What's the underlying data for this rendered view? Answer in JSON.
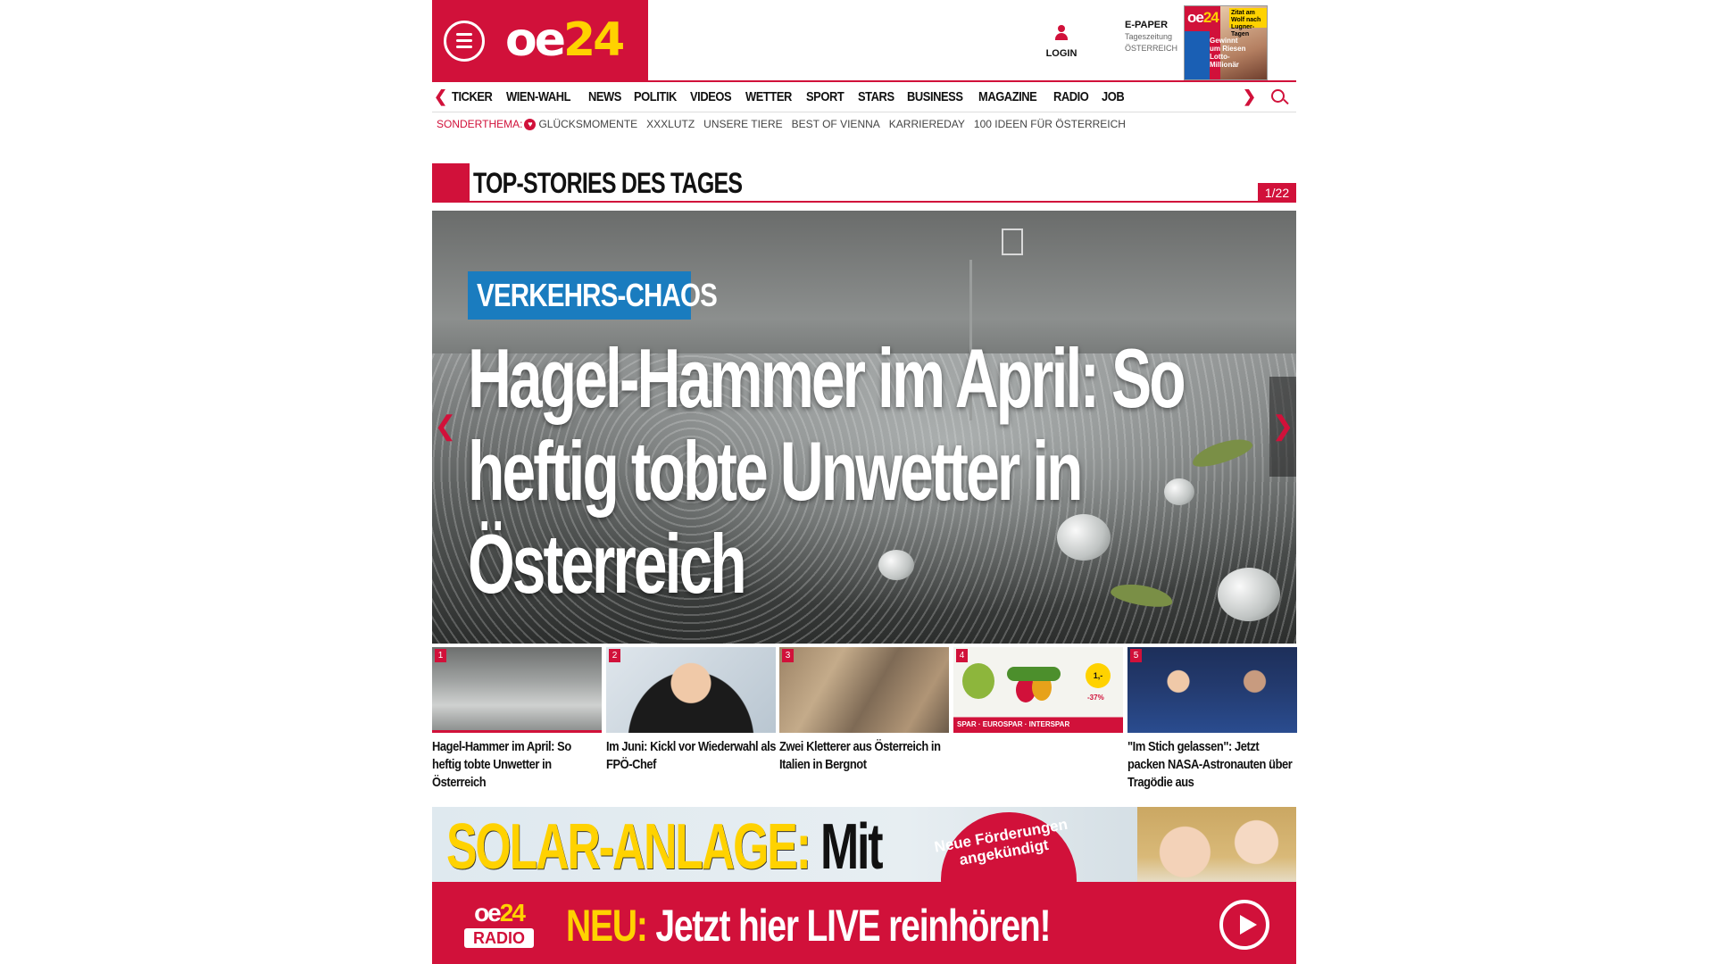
{
  "header": {
    "logo": {
      "part1": "oe",
      "part2": "24"
    },
    "login_label": "LOGIN",
    "epaper": {
      "title": "E-PAPER",
      "subtitle_1": "Tageszeitung",
      "subtitle_2": "ÖSTERREICH",
      "cover_logo_1": "oe",
      "cover_logo_2": "24",
      "cover_headline": "Gewinnt um Riesen Lotto-Millionär",
      "cover_badge": "Zitat am Wolf nach Lugner-Tagen"
    }
  },
  "nav": {
    "items": [
      "TICKER",
      "WIEN-WAHL",
      "NEWS",
      "POLITIK",
      "VIDEOS",
      "WETTER",
      "SPORT",
      "STARS",
      "BUSINESS",
      "MAGAZINE",
      "RADIO",
      "JOB"
    ]
  },
  "subnav": {
    "label": "SONDERTHEMA:",
    "items": [
      "GLÜCKSMOMENTE",
      "XXXLUTZ",
      "UNSERE TIERE",
      "BEST OF VIENNA",
      "KARRIEREDAY",
      "100 IDEEN FÜR ÖSTERREICH"
    ]
  },
  "top_stories": {
    "title": "TOP-STORIES DES TAGES",
    "counter": "1/22"
  },
  "hero": {
    "tag": "VERKEHRS-CHAOS",
    "headline": "Hagel-Hammer im April: So heftig tobte Unwetter in Österreich"
  },
  "thumbs": [
    {
      "num": "1",
      "text": "Hagel-Hammer im April: So heftig tobte Unwetter in Österreich"
    },
    {
      "num": "2",
      "text": "Im Juni: Kickl vor Wiederwahl als FPÖ-Chef"
    },
    {
      "num": "3",
      "text": "Zwei Kletterer aus Österreich in Italien in Bergnot"
    },
    {
      "num": "4",
      "text": ""
    },
    {
      "num": "5",
      "text": "\"Im Stich gelassen\": Jetzt packen NASA-Astronauten über Tragödie aus"
    }
  ],
  "thumb4_ad": {
    "brands": "SPAR · EUROSPAR · INTERSPAR",
    "price": "1,-",
    "discount": "-37%"
  },
  "ad": {
    "headline_yellow": "SOLAR-ANLAGE:",
    "headline_black": "Mit",
    "circle_text": "Neue Förderungen angekündigt",
    "radio_logo_1": "oe",
    "radio_logo_2": "24",
    "radio_label": "RADIO",
    "cta_yellow": "NEU:",
    "cta_white": "Jetzt hier LIVE reinhören!"
  },
  "colors": {
    "brand_red": "#d1113a",
    "brand_yellow": "#ffd200",
    "tag_blue": "#1a7cbf"
  }
}
